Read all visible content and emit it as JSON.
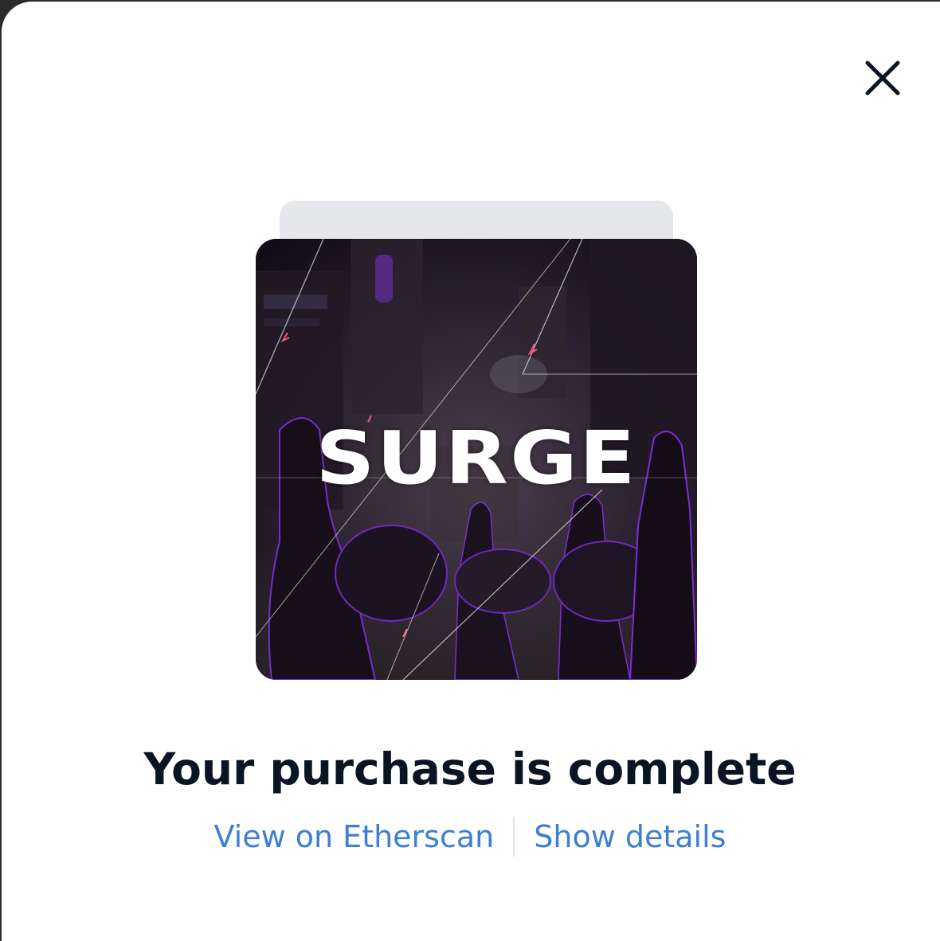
{
  "modal": {
    "close_icon": "close-icon",
    "artwork_title": "SURGE",
    "headline": "Your purchase is complete",
    "links": {
      "etherscan": "View on Etherscan",
      "details": "Show details"
    }
  },
  "colors": {
    "headline": "#0b1424",
    "link": "#3d7fd4",
    "card_stack": "#e6e7ea",
    "accent_purple": "#7a2fd0"
  }
}
